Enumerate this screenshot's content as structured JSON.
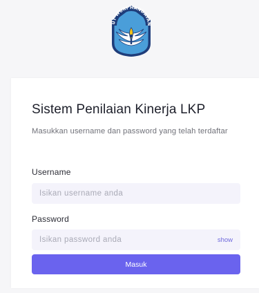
{
  "logo": {
    "name": "tut-wuri-handayani-icon",
    "motto": "TUT WURI HANDAYANI",
    "colors": {
      "sky": "#4a9ed9",
      "navy": "#1f3d7a",
      "flame": "#f3c318"
    }
  },
  "login_card": {
    "title": "Sistem Penilaian Kinerja LKP",
    "subtitle": "Masukkan username dan password yang telah terdaftar",
    "username": {
      "label": "Username",
      "placeholder": "Isikan username anda",
      "value": ""
    },
    "password": {
      "label": "Password",
      "placeholder": "Isikan password anda",
      "value": "",
      "toggle_label": "show"
    },
    "submit_label": "Masuk"
  },
  "colors": {
    "accent": "#6a63ee",
    "input_background": "#f4f3fb",
    "page_background": "#f6f6f8"
  }
}
